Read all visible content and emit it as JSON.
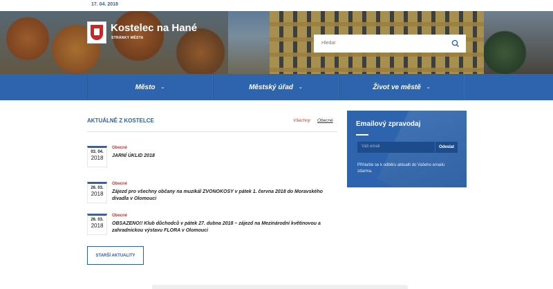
{
  "topbar": {
    "date": "17. 04. 2018"
  },
  "header": {
    "site_title": "Kostelec na Hané",
    "site_subtitle": "STRÁNKY MĚSTA",
    "search_placeholder": "Hledat",
    "search_icon": "search-icon"
  },
  "nav": {
    "items": [
      {
        "label": "Město"
      },
      {
        "label": "Městský úřad"
      },
      {
        "label": "Život ve městě"
      }
    ],
    "chevron": "⌄"
  },
  "news": {
    "heading": "AKTUÁLNĚ Z KOSTELCE",
    "filters": {
      "all": "Všechny",
      "general": "Obecné"
    },
    "items": [
      {
        "day": "03. 04.",
        "year": "2018",
        "category": "Obecné",
        "title": "JARNÍ ÚKLID 2018"
      },
      {
        "day": "26. 03.",
        "year": "2018",
        "category": "Obecné",
        "title": "Zájezd pro všechny občany na muzikál ZVONOKOSY v pátek 1. června 2018 do Moravského divadla v Olomouci"
      },
      {
        "day": "26. 03.",
        "year": "2018",
        "category": "Obecné",
        "title": "OBSAZENO!! Klub důchodců v pátek 27. dubna 2018 – zájezd na Mezinárodní květinovou a zahradnickou výstavu FLORA v Olomouci"
      }
    ],
    "older_button": "STARŠÍ AKTUALITY"
  },
  "newsletter": {
    "heading": "Emailový zpravodaj",
    "email_placeholder": "Váš email",
    "send_label": "Odeslat",
    "note": "Přihlašte se k odběru aktualit do Vašeho emailu zdarma."
  },
  "colors": {
    "brand_blue": "#2d64ad",
    "accent_red": "#d32f2f"
  }
}
